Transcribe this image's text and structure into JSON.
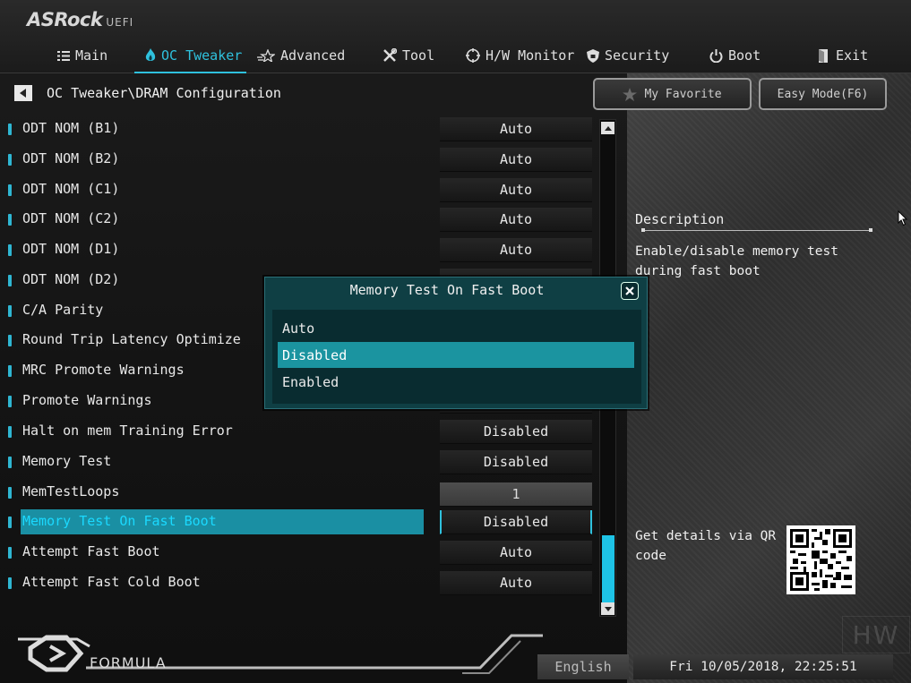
{
  "logo": {
    "brand": "ASRock",
    "sub": "UEFI"
  },
  "nav": {
    "tabs": [
      {
        "label": "Main",
        "icon": "list-icon"
      },
      {
        "label": "OC Tweaker",
        "icon": "flame-icon"
      },
      {
        "label": "Advanced",
        "icon": "star-icon"
      },
      {
        "label": "Tool",
        "icon": "tools-icon"
      },
      {
        "label": "H/W Monitor",
        "icon": "monitor-icon"
      },
      {
        "label": "Security",
        "icon": "shield-icon"
      },
      {
        "label": "Boot",
        "icon": "power-icon"
      },
      {
        "label": "Exit",
        "icon": "exit-icon"
      }
    ],
    "active": "OC Tweaker"
  },
  "breadcrumb": "OC Tweaker\\DRAM Configuration",
  "header_buttons": {
    "favorite": "My Favorite",
    "easy_mode": "Easy Mode(F6)"
  },
  "settings": [
    {
      "label": "ODT NOM (B1)",
      "value": "Auto"
    },
    {
      "label": "ODT NOM (B2)",
      "value": "Auto"
    },
    {
      "label": "ODT NOM (C1)",
      "value": "Auto"
    },
    {
      "label": "ODT NOM (C2)",
      "value": "Auto"
    },
    {
      "label": "ODT NOM (D1)",
      "value": "Auto"
    },
    {
      "label": "ODT NOM (D2)",
      "value": ""
    },
    {
      "label": "C/A Parity",
      "value": ""
    },
    {
      "label": "Round Trip Latency Optimize",
      "value": ""
    },
    {
      "label": "MRC Promote Warnings",
      "value": ""
    },
    {
      "label": "Promote Warnings",
      "value": ""
    },
    {
      "label": "Halt on mem Training Error",
      "value": "Disabled"
    },
    {
      "label": "Memory Test",
      "value": "Disabled"
    },
    {
      "label": "MemTestLoops",
      "value": "1"
    },
    {
      "label": "Memory Test On Fast Boot",
      "value": "Disabled"
    },
    {
      "label": "Attempt Fast Boot",
      "value": "Auto"
    },
    {
      "label": "Attempt Fast Cold Boot",
      "value": "Auto"
    }
  ],
  "description": {
    "title": "Description",
    "text": "Enable/disable memory test during fast boot"
  },
  "qr": {
    "text": "Get details via QR code"
  },
  "footer": {
    "brand": "FORMULA",
    "language": "English",
    "datetime": "Fri 10/05/2018, 22:25:51"
  },
  "watermark": "HW",
  "modal": {
    "title": "Memory Test On Fast Boot",
    "options": [
      "Auto",
      "Disabled",
      "Enabled"
    ],
    "selected": "Disabled"
  },
  "colors": {
    "accent": "#2fc1dd",
    "highlight": "#1b94a0",
    "modal_bg": "#0f3f44"
  }
}
